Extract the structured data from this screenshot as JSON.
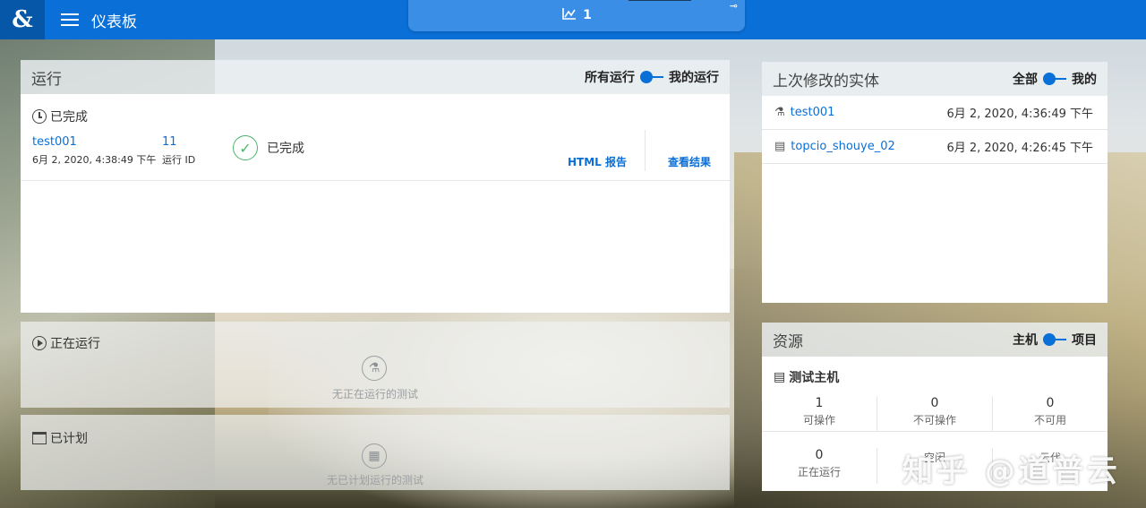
{
  "header": {
    "logo": "&",
    "title": "仪表板",
    "center_tab_count": "1"
  },
  "runs": {
    "title": "运行",
    "toggle_left": "所有运行",
    "toggle_right": "我的运行",
    "completed": {
      "label": "已完成",
      "item": {
        "name": "test001",
        "datetime": "6月 2, 2020, 4:38:49 下午",
        "run_id_value": "11",
        "run_id_label": "运行 ID",
        "status": "已完成",
        "html_report": "HTML 报告",
        "view_results": "查看结果"
      }
    },
    "running": {
      "label": "正在运行",
      "empty_text": "无正在运行的测试"
    },
    "scheduled": {
      "label": "已计划",
      "empty_text": "无已计划运行的测试"
    }
  },
  "entities": {
    "title": "上次修改的实体",
    "toggle_left": "全部",
    "toggle_right": "我的",
    "items": [
      {
        "name": "test001",
        "datetime": "6月 2, 2020, 4:36:49 下午",
        "icon": "test-flask-icon"
      },
      {
        "name": "topcio_shouye_02",
        "datetime": "6月 2, 2020, 4:26:45 下午",
        "icon": "script-doc-icon"
      }
    ]
  },
  "resources": {
    "title": "资源",
    "toggle_left": "主机",
    "toggle_right": "项目",
    "section_label": "测试主机",
    "stats_row1": [
      {
        "value": "1",
        "label": "可操作"
      },
      {
        "value": "0",
        "label": "不可操作"
      },
      {
        "value": "0",
        "label": "不可用"
      }
    ],
    "stats_row2": [
      {
        "value": "0",
        "label": "正在运行"
      },
      {
        "value": "",
        "label": "空闲"
      },
      {
        "value": "",
        "label": "云代"
      }
    ]
  },
  "watermark": "知乎 @道普云",
  "colors": {
    "brand_blue": "#0a6fd6",
    "success_green": "#4cb46b"
  }
}
